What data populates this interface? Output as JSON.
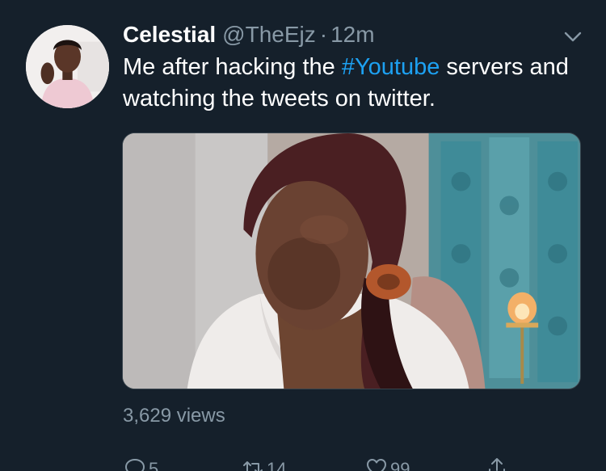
{
  "tweet": {
    "display_name": "Celestial",
    "handle": "@TheEjz",
    "separator": "·",
    "timestamp": "12m",
    "text_before": "Me after hacking the ",
    "hashtag": "#Youtube",
    "text_after": " servers and watching the tweets on twitter.",
    "views": "3,629 views"
  },
  "actions": {
    "reply_count": "5",
    "retweet_count": "14",
    "like_count": "99"
  },
  "icons": {
    "menu": "chevron-down-icon",
    "reply": "reply-icon",
    "retweet": "retweet-icon",
    "like": "heart-icon",
    "share": "share-icon"
  },
  "colors": {
    "background": "#15202b",
    "primary_text": "#ffffff",
    "secondary_text": "#8899a6",
    "link": "#1da1f2",
    "border": "#38444d"
  }
}
